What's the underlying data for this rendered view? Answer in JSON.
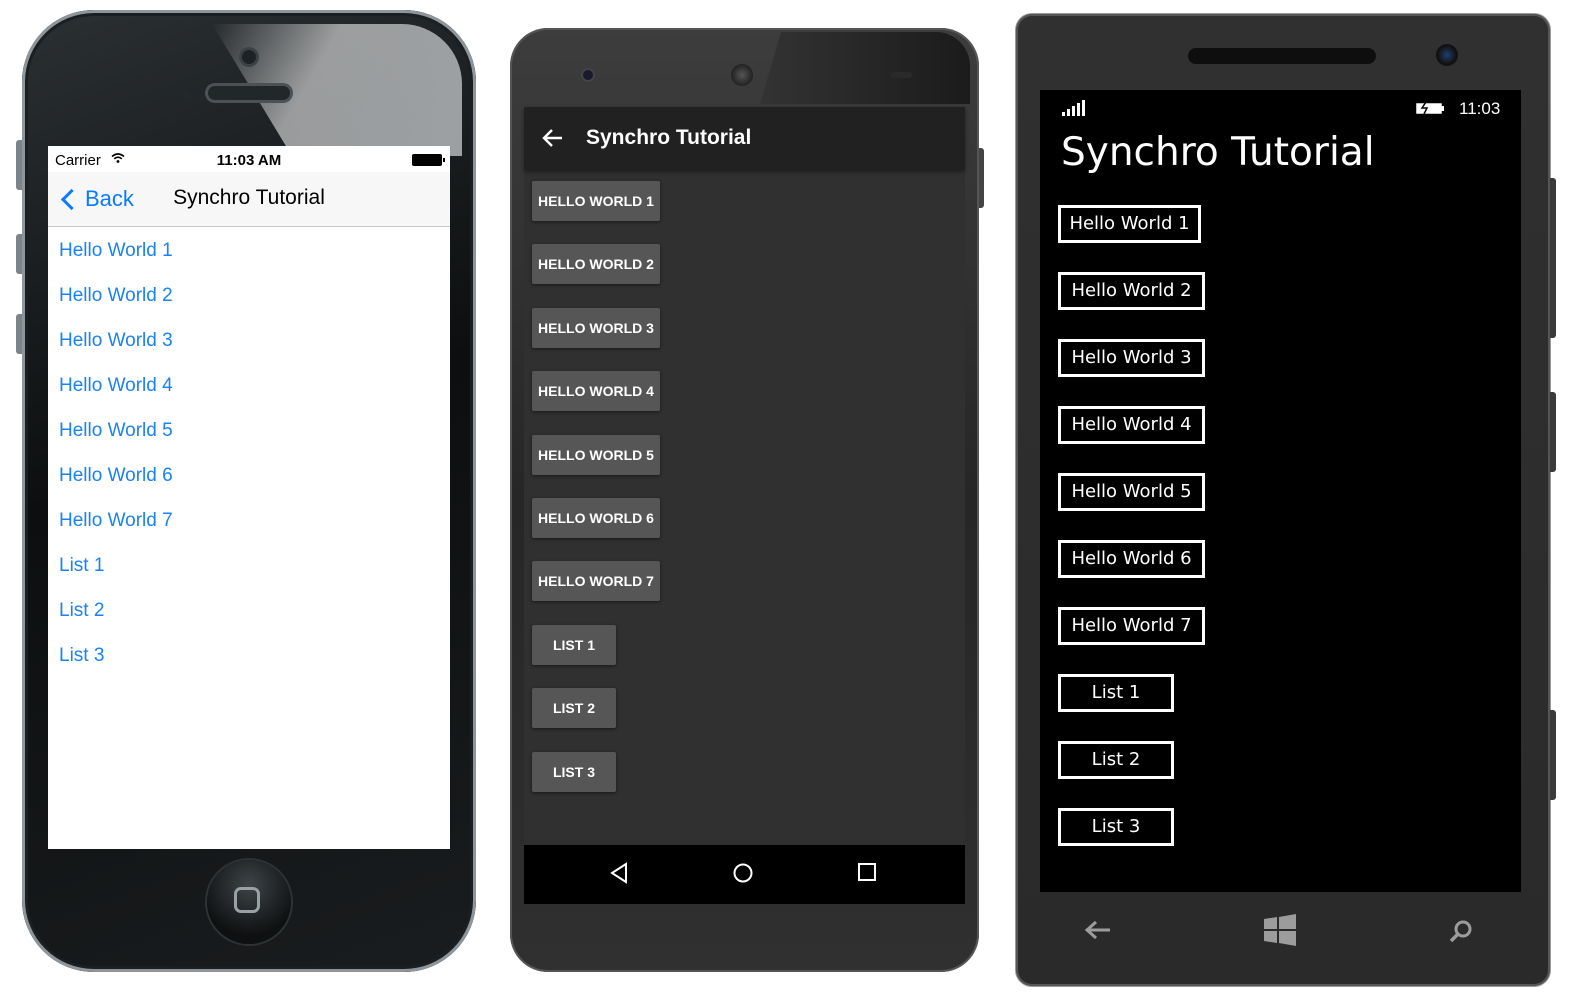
{
  "ios": {
    "status": {
      "carrier": "Carrier",
      "time": "11:03 AM"
    },
    "nav": {
      "back_label": "Back",
      "title": "Synchro Tutorial"
    },
    "items": [
      "Hello World 1",
      "Hello World 2",
      "Hello World 3",
      "Hello World 4",
      "Hello World 5",
      "Hello World 6",
      "Hello World 7",
      "List 1",
      "List 2",
      "List 3"
    ],
    "colors": {
      "link": "#1a82f5",
      "nav_bg": "#f7f7f7"
    }
  },
  "android": {
    "toolbar": {
      "title": "Synchro Tutorial",
      "back_icon": "arrow-left-icon"
    },
    "buttons": [
      "HELLO WORLD 1",
      "HELLO WORLD 2",
      "HELLO WORLD 3",
      "HELLO WORLD 4",
      "HELLO WORLD 5",
      "HELLO WORLD 6",
      "HELLO WORLD 7",
      "LIST 1",
      "LIST 2",
      "LIST 3"
    ],
    "nav_icons": [
      "back-triangle-icon",
      "home-circle-icon",
      "recents-square-icon"
    ],
    "colors": {
      "bg": "#303030",
      "toolbar": "#212121",
      "button": "#565656"
    }
  },
  "winphone": {
    "status": {
      "time": "11:03"
    },
    "title": "Synchro Tutorial",
    "buttons": [
      "Hello World 1",
      "Hello World 2",
      "Hello World 3",
      "Hello World 4",
      "Hello World 5",
      "Hello World 6",
      "Hello World 7",
      "List 1",
      "List 2",
      "List 3"
    ],
    "nav_icons": [
      "back-arrow-icon",
      "windows-logo-icon",
      "search-icon"
    ],
    "colors": {
      "bg": "#000000",
      "fg": "#ffffff"
    }
  }
}
